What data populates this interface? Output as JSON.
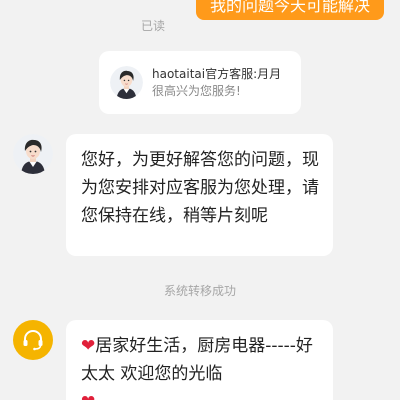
{
  "outgoing": {
    "text": "我的问题今天可能解决",
    "read_status": "已读"
  },
  "agent_card": {
    "name": "haotaitai官方客服:月月",
    "greeting": "很高兴为您服务!"
  },
  "messages": [
    {
      "text": "您好，为更好解答您的问题，现为您安排对应客服为您处理，请您保持在线，稍等片刻呢"
    }
  ],
  "system_note": "系统转移成功",
  "message2": {
    "heart": "❤",
    "text": "居家好生活，厨房电器-----好太太  欢迎您的光临",
    "trailing_heart": "❤"
  },
  "colors": {
    "accent": "#ff9a1a",
    "background": "#f2f2f2",
    "hotline_avatar": "#f5b400",
    "heart": "#e0203a"
  },
  "icons": {
    "agent_avatar": "female-agent-avatar-icon",
    "hotline_avatar": "headset-icon"
  }
}
